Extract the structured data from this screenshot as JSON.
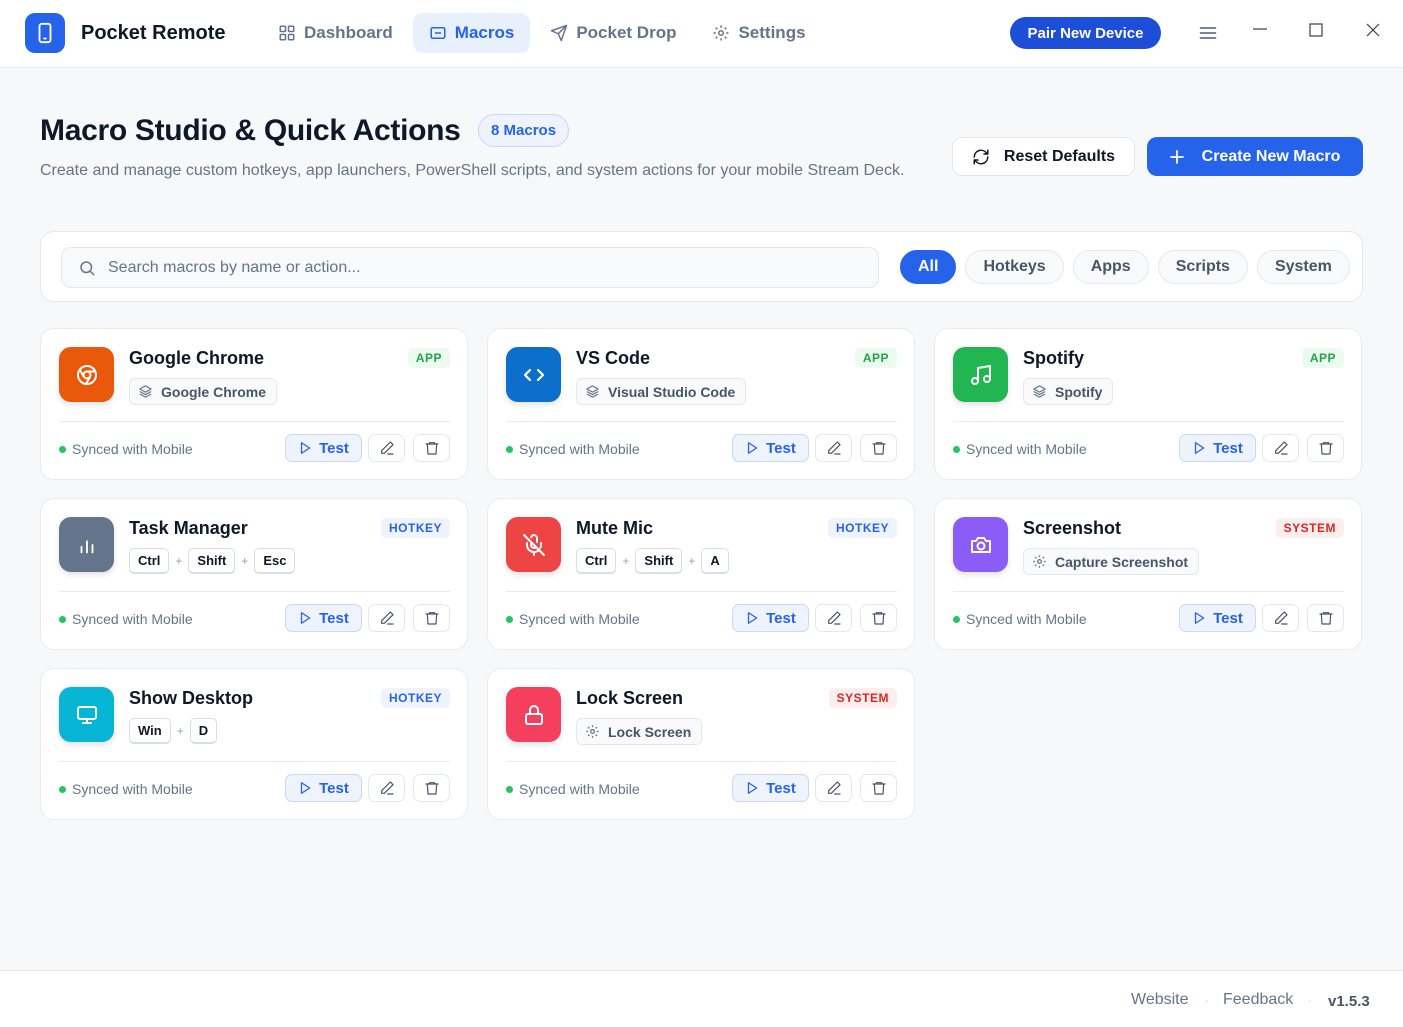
{
  "app": {
    "name": "Pocket Remote"
  },
  "nav": [
    {
      "label": "Dashboard"
    },
    {
      "label": "Macros"
    },
    {
      "label": "Pocket Drop"
    },
    {
      "label": "Settings"
    }
  ],
  "header": {
    "pair_label": "Pair New Device",
    "title": "Macro Studio & Quick Actions",
    "count_badge": "8 Macros",
    "subtitle": "Create and manage custom hotkeys, app launchers, PowerShell scripts, and system actions for your mobile Stream Deck.",
    "reset_label": "Reset Defaults",
    "create_label": "Create New Macro"
  },
  "search": {
    "placeholder": "Search macros by name or action..."
  },
  "filters": [
    "All",
    "Hotkeys",
    "Apps",
    "Scripts",
    "System"
  ],
  "card_labels": {
    "sync": "Synced with Mobile",
    "test": "Test",
    "plus": "+"
  },
  "macros": [
    {
      "title": "Google Chrome",
      "type": "APP",
      "icon": "chrome-icon",
      "color": "#ea580c",
      "action": "Google Chrome",
      "action_icon": "layers-icon"
    },
    {
      "title": "VS Code",
      "type": "APP",
      "icon": "code-icon",
      "color": "#0b6fcb",
      "action": "Visual Studio Code",
      "action_icon": "layers-icon"
    },
    {
      "title": "Spotify",
      "type": "APP",
      "icon": "music-icon",
      "color": "#22b653",
      "action": "Spotify",
      "action_icon": "layers-icon"
    },
    {
      "title": "Task Manager",
      "type": "HOTKEY",
      "icon": "bar-chart-icon",
      "color": "#64748b",
      "keys": [
        "Ctrl",
        "Shift",
        "Esc"
      ]
    },
    {
      "title": "Mute Mic",
      "type": "HOTKEY",
      "icon": "mic-off-icon",
      "color": "#ef4444",
      "keys": [
        "Ctrl",
        "Shift",
        "A"
      ]
    },
    {
      "title": "Screenshot",
      "type": "SYSTEM",
      "icon": "camera-icon",
      "color": "#8b5cf6",
      "action": "Capture Screenshot",
      "action_icon": "gear-icon"
    },
    {
      "title": "Show Desktop",
      "type": "HOTKEY",
      "icon": "monitor-icon",
      "color": "#06b6d4",
      "keys": [
        "Win",
        "D"
      ]
    },
    {
      "title": "Lock Screen",
      "type": "SYSTEM",
      "icon": "lock-icon",
      "color": "#f43f5e",
      "action": "Lock Screen",
      "action_icon": "gear-icon"
    }
  ],
  "footer": {
    "website": "Website",
    "feedback": "Feedback",
    "version": "v1.5.3"
  }
}
